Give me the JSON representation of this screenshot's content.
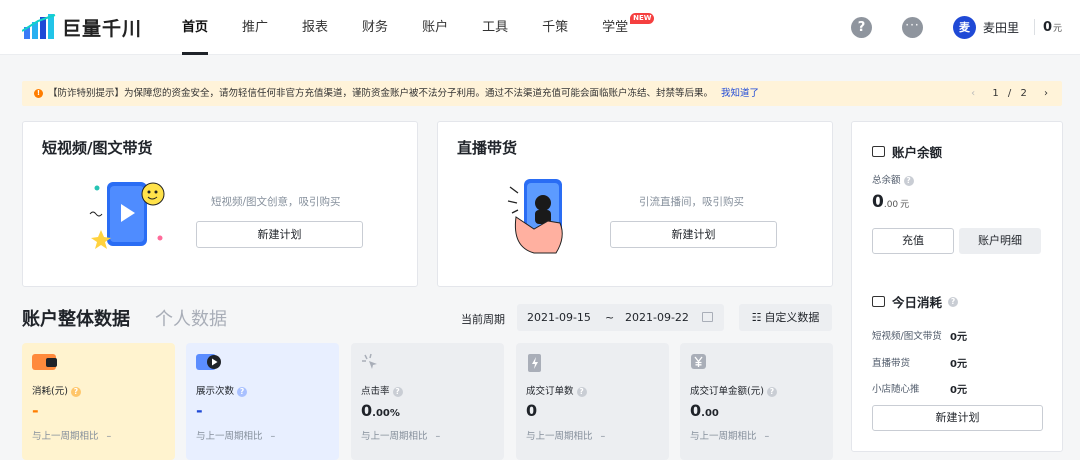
{
  "header": {
    "logo_text": "巨量千川",
    "nav": [
      {
        "label": "首页",
        "active": true
      },
      {
        "label": "推广"
      },
      {
        "label": "报表"
      },
      {
        "label": "财务"
      },
      {
        "label": "账户"
      },
      {
        "label": "工具"
      },
      {
        "label": "千策"
      },
      {
        "label": "学堂",
        "badge": "NEW"
      }
    ],
    "help_icon": "?",
    "more_icon": "···",
    "avatar_text": "麦",
    "user_name": "麦田里",
    "balance": "0",
    "balance_unit": "元"
  },
  "notice": {
    "text": "【防诈特别提示】为保障您的资金安全，请勿轻信任何非官方充值渠道，谨防资金账户被不法分子利用。通过不法渠道充值可能会面临账户冻结、封禁等后果。",
    "link": "我知道了",
    "page_current": "1",
    "page_sep": "/",
    "page_total": "2",
    "prev": "‹",
    "next": "›"
  },
  "cards": [
    {
      "title": "短视频/图文带货",
      "desc": "短视频/图文创意，吸引购买",
      "button": "新建计划"
    },
    {
      "title": "直播带货",
      "desc": "引流直播间，吸引购买",
      "button": "新建计划"
    }
  ],
  "account_panel": {
    "title": "账户余额",
    "total_label": "总余额",
    "total_int": "0",
    "total_dec": ".00",
    "total_unit": "元",
    "recharge_button": "充值",
    "detail_button": "账户明细",
    "spend_title": "今日消耗",
    "spend_rows": [
      {
        "label": "短视频/图文带货",
        "value": "0元"
      },
      {
        "label": "直播带货",
        "value": "0元"
      },
      {
        "label": "小店随心推",
        "value": "0元"
      }
    ],
    "new_plan_button": "新建计划"
  },
  "data_section": {
    "title": "账户整体数据",
    "tab_personal": "个人数据",
    "period_label": "当前周期",
    "date_start": "2021-09-15",
    "date_tilde": "~",
    "date_end": "2021-09-22",
    "custom_button": "自定义数据",
    "metrics": [
      {
        "label": "消耗(元)",
        "value": "-",
        "compare": "与上一周期相比",
        "compare_value": "–",
        "color": "#fff3cf",
        "value_color": "#ff7d00"
      },
      {
        "label": "展示次数",
        "value": "-",
        "compare": "与上一周期相比",
        "compare_value": "–",
        "color": "#e8efff",
        "value_color": "#1f49d6"
      },
      {
        "label": "点击率",
        "value_int": "0",
        "value_dec": ".00%",
        "compare": "与上一周期相比",
        "compare_value": "–",
        "color": "#eceef1"
      },
      {
        "label": "成交订单数",
        "value": "0",
        "compare": "与上一周期相比",
        "compare_value": "–",
        "color": "#eceef1"
      },
      {
        "label": "成交订单金额(元)",
        "value_int": "0",
        "value_dec": ".00",
        "compare": "与上一周期相比",
        "compare_value": "–",
        "color": "#eceef1"
      }
    ]
  },
  "colors": {
    "accent": "#1f49d6",
    "warning_bg": "#fff3d9",
    "warning_icon": "#ff7d00"
  }
}
